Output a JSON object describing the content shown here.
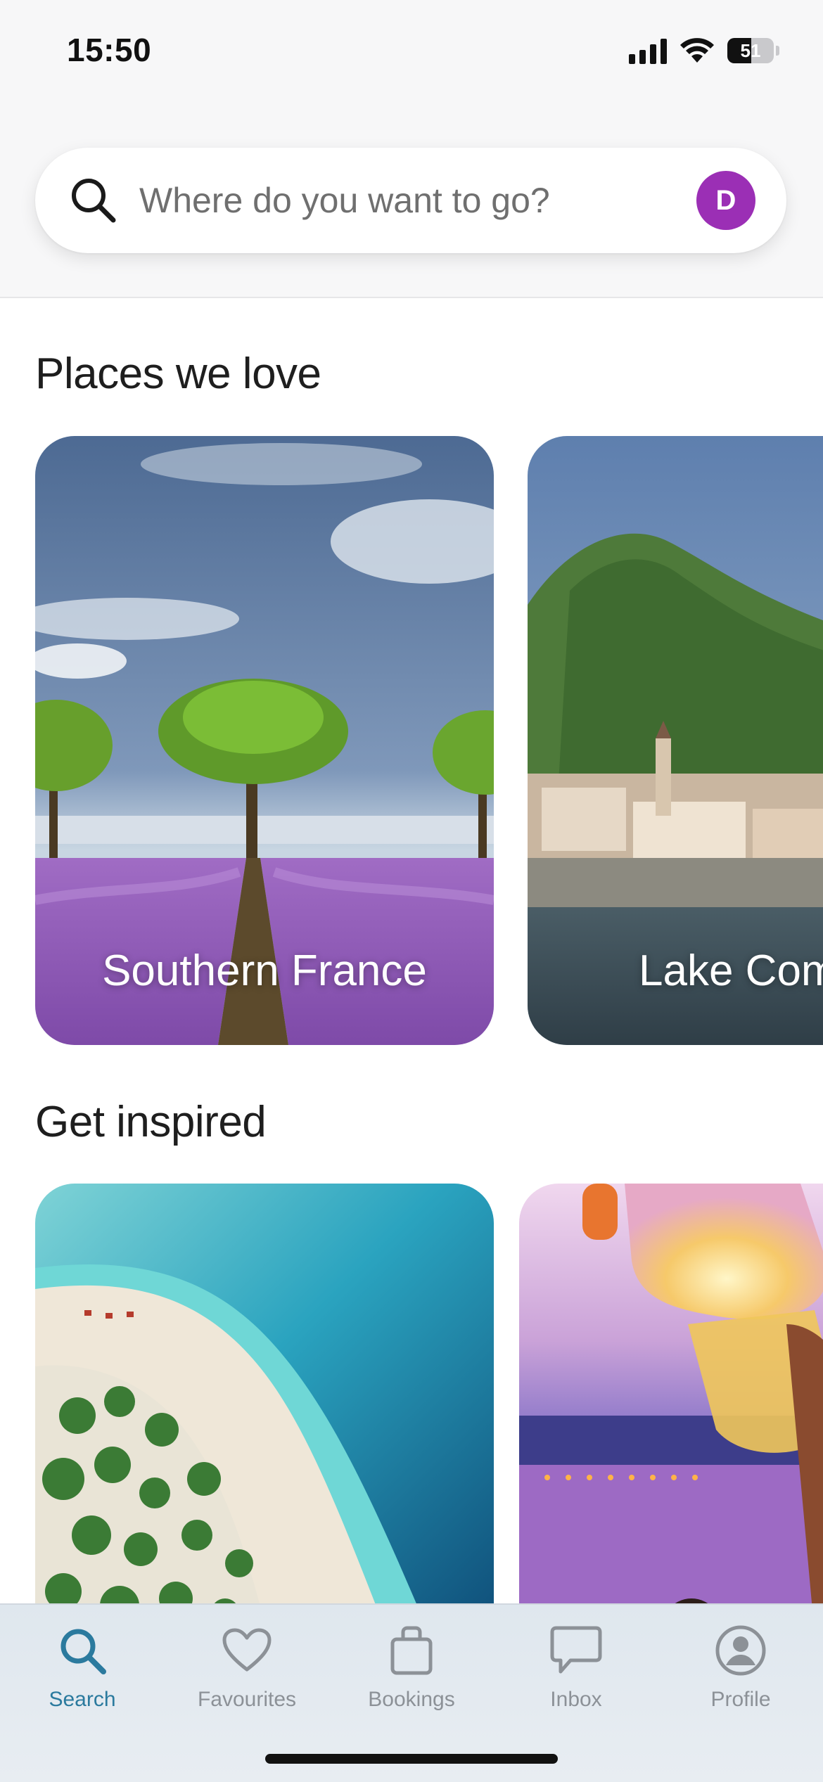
{
  "status_bar": {
    "time": "15:50",
    "battery": "51",
    "battery_level": 0.51
  },
  "search": {
    "placeholder": "Where do you want to go?",
    "avatar_initial": "D"
  },
  "sections": [
    {
      "title": "Places we love",
      "cards": [
        "Southern France",
        "Lake Como"
      ]
    },
    {
      "title": "Get inspired"
    }
  ],
  "tabs": [
    {
      "label": "Search",
      "icon": "search-icon",
      "active": true
    },
    {
      "label": "Favourites",
      "icon": "heart-icon"
    },
    {
      "label": "Bookings",
      "icon": "bag-icon"
    },
    {
      "label": "Inbox",
      "icon": "chat-bubble-icon"
    },
    {
      "label": "Profile",
      "icon": "profile-icon"
    }
  ],
  "colors": {
    "accent": "#2b7a9e",
    "avatar": "#9b2fb5",
    "inactive_tab": "#8c9197"
  }
}
